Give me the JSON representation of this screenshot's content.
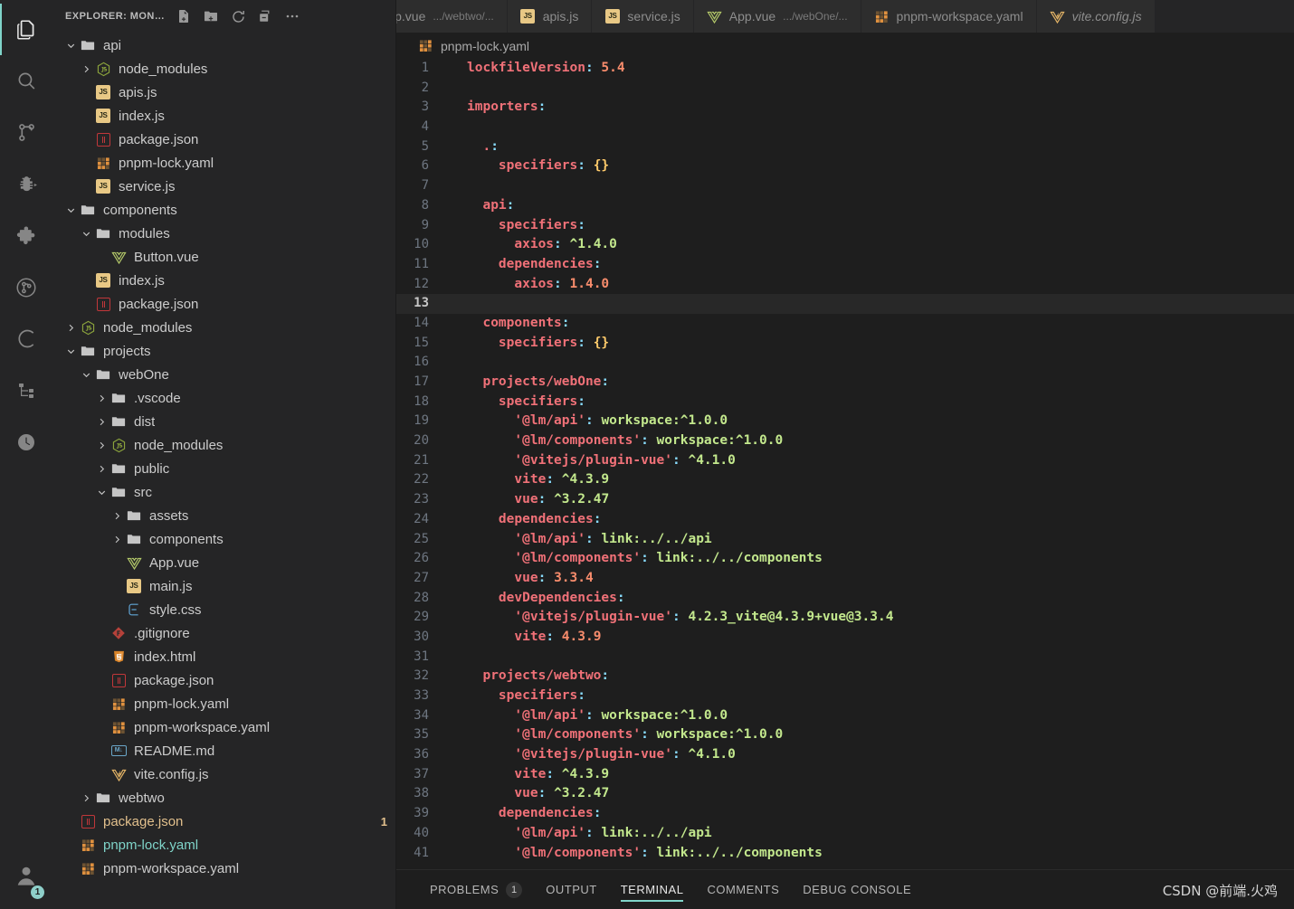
{
  "activitybar": {
    "items": [
      {
        "name": "explorer",
        "icon": "files-icon",
        "active": true
      },
      {
        "name": "search",
        "icon": "search-icon",
        "active": false
      },
      {
        "name": "source-control",
        "icon": "source-control-icon",
        "active": false
      },
      {
        "name": "run-and-debug",
        "icon": "debug-icon",
        "active": false
      },
      {
        "name": "extensions",
        "icon": "extensions-icon",
        "active": false
      },
      {
        "name": "gitlens",
        "icon": "gitlens-icon",
        "active": false
      },
      {
        "name": "codeium",
        "icon": "letter-c-icon",
        "active": false
      },
      {
        "name": "outline-structure",
        "icon": "tree-structure-icon",
        "active": false
      },
      {
        "name": "timeline",
        "icon": "clock-icon",
        "active": false
      }
    ],
    "account": {
      "icon": "account-icon",
      "badge": "1"
    },
    "accent": "#7fd4c9"
  },
  "sidebar": {
    "title": "EXPLORER: MON…",
    "actions": [
      {
        "name": "new-file",
        "label": "New File"
      },
      {
        "name": "new-folder",
        "label": "New Folder"
      },
      {
        "name": "refresh-explorer",
        "label": "Refresh Explorer"
      },
      {
        "name": "collapse-folders",
        "label": "Collapse Folders in Explorer"
      },
      {
        "name": "more-actions",
        "label": "Views and More Actions..."
      }
    ],
    "tree": [
      {
        "label": "api",
        "icon": "folder-icon",
        "depth": 0,
        "twisty": "down"
      },
      {
        "label": "node_modules",
        "icon": "nodejs-icon",
        "depth": 1,
        "twisty": "right"
      },
      {
        "label": "apis.js",
        "icon": "js-icon",
        "depth": 1,
        "twisty": "none"
      },
      {
        "label": "index.js",
        "icon": "js-icon",
        "depth": 1,
        "twisty": "none"
      },
      {
        "label": "package.json",
        "icon": "json-icon",
        "depth": 1,
        "twisty": "none"
      },
      {
        "label": "pnpm-lock.yaml",
        "icon": "yaml-icon",
        "depth": 1,
        "twisty": "none"
      },
      {
        "label": "service.js",
        "icon": "js-icon",
        "depth": 1,
        "twisty": "none"
      },
      {
        "label": "components",
        "icon": "folder-icon",
        "depth": 0,
        "twisty": "down"
      },
      {
        "label": "modules",
        "icon": "folder-icon",
        "depth": 1,
        "twisty": "down"
      },
      {
        "label": "Button.vue",
        "icon": "vue-icon",
        "depth": 2,
        "twisty": "none"
      },
      {
        "label": "index.js",
        "icon": "js-icon",
        "depth": 1,
        "twisty": "none"
      },
      {
        "label": "package.json",
        "icon": "json-icon",
        "depth": 1,
        "twisty": "none"
      },
      {
        "label": "node_modules",
        "icon": "nodejs-icon",
        "depth": 0,
        "twisty": "right"
      },
      {
        "label": "projects",
        "icon": "folder-icon",
        "depth": 0,
        "twisty": "down"
      },
      {
        "label": "webOne",
        "icon": "folder-icon",
        "depth": 1,
        "twisty": "down"
      },
      {
        "label": ".vscode",
        "icon": "folder-icon",
        "depth": 2,
        "twisty": "right"
      },
      {
        "label": "dist",
        "icon": "folder-icon",
        "depth": 2,
        "twisty": "right"
      },
      {
        "label": "node_modules",
        "icon": "nodejs-icon",
        "depth": 2,
        "twisty": "right"
      },
      {
        "label": "public",
        "icon": "folder-icon",
        "depth": 2,
        "twisty": "right"
      },
      {
        "label": "src",
        "icon": "folder-icon",
        "depth": 2,
        "twisty": "down"
      },
      {
        "label": "assets",
        "icon": "folder-icon",
        "depth": 3,
        "twisty": "right"
      },
      {
        "label": "components",
        "icon": "folder-icon",
        "depth": 3,
        "twisty": "right"
      },
      {
        "label": "App.vue",
        "icon": "vue-icon",
        "depth": 3,
        "twisty": "none"
      },
      {
        "label": "main.js",
        "icon": "js-icon",
        "depth": 3,
        "twisty": "none"
      },
      {
        "label": "style.css",
        "icon": "css-icon",
        "depth": 3,
        "twisty": "none"
      },
      {
        "label": ".gitignore",
        "icon": "git-icon",
        "depth": 2,
        "twisty": "none"
      },
      {
        "label": "index.html",
        "icon": "html-icon",
        "depth": 2,
        "twisty": "none"
      },
      {
        "label": "package.json",
        "icon": "json-icon",
        "depth": 2,
        "twisty": "none"
      },
      {
        "label": "pnpm-lock.yaml",
        "icon": "yaml-icon",
        "depth": 2,
        "twisty": "none"
      },
      {
        "label": "pnpm-workspace.yaml",
        "icon": "yaml-icon",
        "depth": 2,
        "twisty": "none"
      },
      {
        "label": "README.md",
        "icon": "markdown-icon",
        "depth": 2,
        "twisty": "none"
      },
      {
        "label": "vite.config.js",
        "icon": "vite-icon",
        "depth": 2,
        "twisty": "none"
      },
      {
        "label": "webtwo",
        "icon": "folder-icon",
        "depth": 1,
        "twisty": "right"
      },
      {
        "label": "package.json",
        "icon": "json-icon",
        "depth": 0,
        "twisty": "none",
        "state": "mod-yellow",
        "count": "1"
      },
      {
        "label": "pnpm-lock.yaml",
        "icon": "yaml-icon",
        "depth": 0,
        "twisty": "none",
        "state": "mod-cyan"
      },
      {
        "label": "pnpm-workspace.yaml",
        "icon": "yaml-icon",
        "depth": 0,
        "twisty": "none"
      }
    ]
  },
  "tabs": [
    {
      "name": "App.vue",
      "desc": ".../webtwo/...",
      "icon": "vue-icon",
      "active": false,
      "preview": false,
      "truncated": true
    },
    {
      "name": "apis.js",
      "desc": "",
      "icon": "js-icon",
      "active": false,
      "preview": false
    },
    {
      "name": "service.js",
      "desc": "",
      "icon": "js-icon",
      "active": false,
      "preview": false
    },
    {
      "name": "App.vue",
      "desc": ".../webOne/...",
      "icon": "vue-icon",
      "active": false,
      "preview": false
    },
    {
      "name": "pnpm-workspace.yaml",
      "desc": "",
      "icon": "yaml-icon",
      "active": false,
      "preview": false
    },
    {
      "name": "vite.config.js",
      "desc": "",
      "icon": "vite-icon",
      "active": false,
      "preview": true
    }
  ],
  "breadcrumb": {
    "file": "pnpm-lock.yaml",
    "icon": "yaml-icon"
  },
  "editor": {
    "active_line": 13,
    "lines": [
      {
        "n": 1,
        "tokens": [
          {
            "t": "lockfileVersion",
            "c": "k"
          },
          {
            "t": ":",
            "c": "p"
          },
          {
            "t": " ",
            "c": ""
          },
          {
            "t": "5.4",
            "c": "n"
          }
        ],
        "indent": 0
      },
      {
        "n": 2,
        "tokens": [],
        "indent": 0
      },
      {
        "n": 3,
        "tokens": [
          {
            "t": "importers",
            "c": "k"
          },
          {
            "t": ":",
            "c": "p"
          }
        ],
        "indent": 0
      },
      {
        "n": 4,
        "tokens": [],
        "indent": 0
      },
      {
        "n": 5,
        "tokens": [
          {
            "t": ".",
            "c": "k"
          },
          {
            "t": ":",
            "c": "p"
          }
        ],
        "indent": 1
      },
      {
        "n": 6,
        "tokens": [
          {
            "t": "specifiers",
            "c": "k"
          },
          {
            "t": ":",
            "c": "p"
          },
          {
            "t": " ",
            "c": ""
          },
          {
            "t": "{}",
            "c": "b"
          }
        ],
        "indent": 2
      },
      {
        "n": 7,
        "tokens": [],
        "indent": 0
      },
      {
        "n": 8,
        "tokens": [
          {
            "t": "api",
            "c": "k"
          },
          {
            "t": ":",
            "c": "p"
          }
        ],
        "indent": 1
      },
      {
        "n": 9,
        "tokens": [
          {
            "t": "specifiers",
            "c": "k"
          },
          {
            "t": ":",
            "c": "p"
          }
        ],
        "indent": 2
      },
      {
        "n": 10,
        "tokens": [
          {
            "t": "axios",
            "c": "k"
          },
          {
            "t": ":",
            "c": "p"
          },
          {
            "t": " ",
            "c": ""
          },
          {
            "t": "^1.4.0",
            "c": "s"
          }
        ],
        "indent": 3
      },
      {
        "n": 11,
        "tokens": [
          {
            "t": "dependencies",
            "c": "k"
          },
          {
            "t": ":",
            "c": "p"
          }
        ],
        "indent": 2
      },
      {
        "n": 12,
        "tokens": [
          {
            "t": "axios",
            "c": "k"
          },
          {
            "t": ":",
            "c": "p"
          },
          {
            "t": " ",
            "c": ""
          },
          {
            "t": "1.4.0",
            "c": "n"
          }
        ],
        "indent": 3
      },
      {
        "n": 13,
        "tokens": [],
        "indent": 0
      },
      {
        "n": 14,
        "tokens": [
          {
            "t": "components",
            "c": "k"
          },
          {
            "t": ":",
            "c": "p"
          }
        ],
        "indent": 1
      },
      {
        "n": 15,
        "tokens": [
          {
            "t": "specifiers",
            "c": "k"
          },
          {
            "t": ":",
            "c": "p"
          },
          {
            "t": " ",
            "c": ""
          },
          {
            "t": "{}",
            "c": "b"
          }
        ],
        "indent": 2
      },
      {
        "n": 16,
        "tokens": [],
        "indent": 0
      },
      {
        "n": 17,
        "tokens": [
          {
            "t": "projects/webOne",
            "c": "k"
          },
          {
            "t": ":",
            "c": "p"
          }
        ],
        "indent": 1
      },
      {
        "n": 18,
        "tokens": [
          {
            "t": "specifiers",
            "c": "k"
          },
          {
            "t": ":",
            "c": "p"
          }
        ],
        "indent": 2
      },
      {
        "n": 19,
        "tokens": [
          {
            "t": "'@lm/api'",
            "c": "q"
          },
          {
            "t": ":",
            "c": "p"
          },
          {
            "t": " ",
            "c": ""
          },
          {
            "t": "workspace:^1.0.0",
            "c": "s"
          }
        ],
        "indent": 3
      },
      {
        "n": 20,
        "tokens": [
          {
            "t": "'@lm/components'",
            "c": "q"
          },
          {
            "t": ":",
            "c": "p"
          },
          {
            "t": " ",
            "c": ""
          },
          {
            "t": "workspace:^1.0.0",
            "c": "s"
          }
        ],
        "indent": 3
      },
      {
        "n": 21,
        "tokens": [
          {
            "t": "'@vitejs/plugin-vue'",
            "c": "q"
          },
          {
            "t": ":",
            "c": "p"
          },
          {
            "t": " ",
            "c": ""
          },
          {
            "t": "^4.1.0",
            "c": "s"
          }
        ],
        "indent": 3
      },
      {
        "n": 22,
        "tokens": [
          {
            "t": "vite",
            "c": "k"
          },
          {
            "t": ":",
            "c": "p"
          },
          {
            "t": " ",
            "c": ""
          },
          {
            "t": "^4.3.9",
            "c": "s"
          }
        ],
        "indent": 3
      },
      {
        "n": 23,
        "tokens": [
          {
            "t": "vue",
            "c": "k"
          },
          {
            "t": ":",
            "c": "p"
          },
          {
            "t": " ",
            "c": ""
          },
          {
            "t": "^3.2.47",
            "c": "s"
          }
        ],
        "indent": 3
      },
      {
        "n": 24,
        "tokens": [
          {
            "t": "dependencies",
            "c": "k"
          },
          {
            "t": ":",
            "c": "p"
          }
        ],
        "indent": 2
      },
      {
        "n": 25,
        "tokens": [
          {
            "t": "'@lm/api'",
            "c": "q"
          },
          {
            "t": ":",
            "c": "p"
          },
          {
            "t": " ",
            "c": ""
          },
          {
            "t": "link:../../api",
            "c": "s"
          }
        ],
        "indent": 3
      },
      {
        "n": 26,
        "tokens": [
          {
            "t": "'@lm/components'",
            "c": "q"
          },
          {
            "t": ":",
            "c": "p"
          },
          {
            "t": " ",
            "c": ""
          },
          {
            "t": "link:../../components",
            "c": "s"
          }
        ],
        "indent": 3
      },
      {
        "n": 27,
        "tokens": [
          {
            "t": "vue",
            "c": "k"
          },
          {
            "t": ":",
            "c": "p"
          },
          {
            "t": " ",
            "c": ""
          },
          {
            "t": "3.3.4",
            "c": "n"
          }
        ],
        "indent": 3
      },
      {
        "n": 28,
        "tokens": [
          {
            "t": "devDependencies",
            "c": "k"
          },
          {
            "t": ":",
            "c": "p"
          }
        ],
        "indent": 2
      },
      {
        "n": 29,
        "tokens": [
          {
            "t": "'@vitejs/plugin-vue'",
            "c": "q"
          },
          {
            "t": ":",
            "c": "p"
          },
          {
            "t": " ",
            "c": ""
          },
          {
            "t": "4.2.3_vite@4.3.9+vue@3.3.4",
            "c": "s"
          }
        ],
        "indent": 3
      },
      {
        "n": 30,
        "tokens": [
          {
            "t": "vite",
            "c": "k"
          },
          {
            "t": ":",
            "c": "p"
          },
          {
            "t": " ",
            "c": ""
          },
          {
            "t": "4.3.9",
            "c": "n"
          }
        ],
        "indent": 3
      },
      {
        "n": 31,
        "tokens": [],
        "indent": 0
      },
      {
        "n": 32,
        "tokens": [
          {
            "t": "projects/webtwo",
            "c": "k"
          },
          {
            "t": ":",
            "c": "p"
          }
        ],
        "indent": 1
      },
      {
        "n": 33,
        "tokens": [
          {
            "t": "specifiers",
            "c": "k"
          },
          {
            "t": ":",
            "c": "p"
          }
        ],
        "indent": 2
      },
      {
        "n": 34,
        "tokens": [
          {
            "t": "'@lm/api'",
            "c": "q"
          },
          {
            "t": ":",
            "c": "p"
          },
          {
            "t": " ",
            "c": ""
          },
          {
            "t": "workspace:^1.0.0",
            "c": "s"
          }
        ],
        "indent": 3
      },
      {
        "n": 35,
        "tokens": [
          {
            "t": "'@lm/components'",
            "c": "q"
          },
          {
            "t": ":",
            "c": "p"
          },
          {
            "t": " ",
            "c": ""
          },
          {
            "t": "workspace:^1.0.0",
            "c": "s"
          }
        ],
        "indent": 3
      },
      {
        "n": 36,
        "tokens": [
          {
            "t": "'@vitejs/plugin-vue'",
            "c": "q"
          },
          {
            "t": ":",
            "c": "p"
          },
          {
            "t": " ",
            "c": ""
          },
          {
            "t": "^4.1.0",
            "c": "s"
          }
        ],
        "indent": 3
      },
      {
        "n": 37,
        "tokens": [
          {
            "t": "vite",
            "c": "k"
          },
          {
            "t": ":",
            "c": "p"
          },
          {
            "t": " ",
            "c": ""
          },
          {
            "t": "^4.3.9",
            "c": "s"
          }
        ],
        "indent": 3
      },
      {
        "n": 38,
        "tokens": [
          {
            "t": "vue",
            "c": "k"
          },
          {
            "t": ":",
            "c": "p"
          },
          {
            "t": " ",
            "c": ""
          },
          {
            "t": "^3.2.47",
            "c": "s"
          }
        ],
        "indent": 3
      },
      {
        "n": 39,
        "tokens": [
          {
            "t": "dependencies",
            "c": "k"
          },
          {
            "t": ":",
            "c": "p"
          }
        ],
        "indent": 2
      },
      {
        "n": 40,
        "tokens": [
          {
            "t": "'@lm/api'",
            "c": "q"
          },
          {
            "t": ":",
            "c": "p"
          },
          {
            "t": " ",
            "c": ""
          },
          {
            "t": "link:../../api",
            "c": "s"
          }
        ],
        "indent": 3
      },
      {
        "n": 41,
        "tokens": [
          {
            "t": "'@lm/components'",
            "c": "q"
          },
          {
            "t": ":",
            "c": "p"
          },
          {
            "t": " ",
            "c": ""
          },
          {
            "t": "link:../../components",
            "c": "s"
          }
        ],
        "indent": 3
      }
    ]
  },
  "panel": {
    "tabs": [
      {
        "label": "PROBLEMS",
        "badge": "1",
        "active": false
      },
      {
        "label": "OUTPUT",
        "badge": "",
        "active": false
      },
      {
        "label": "TERMINAL",
        "badge": "",
        "active": true
      },
      {
        "label": "COMMENTS",
        "badge": "",
        "active": false
      },
      {
        "label": "DEBUG CONSOLE",
        "badge": "",
        "active": false
      }
    ]
  },
  "watermark": "CSDN @前端.火鸡"
}
